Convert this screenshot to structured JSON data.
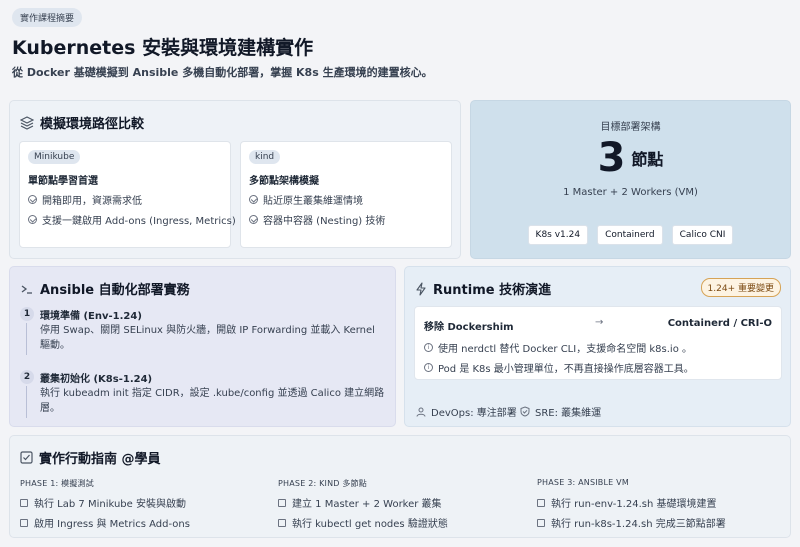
{
  "header": {
    "badge": "實作課程摘要",
    "title": "Kubernetes 安裝與環境建構實作",
    "subtitle": "從 Docker 基礎模擬到 Ansible 多機自動化部署，掌握 K8s 生產環境的建置核心。"
  },
  "env": {
    "title": "模擬環境路徑比較",
    "cards": [
      {
        "tag": "Minikube",
        "title": "單節點學習首選",
        "items": [
          "開箱即用，資源需求低",
          "支援一鍵啟用 Add-ons (Ingress, Metrics)"
        ]
      },
      {
        "tag": "kind",
        "title": "多節點架構模擬",
        "items": [
          "貼近原生叢集維運情境",
          "容器中容器 (Nesting) 技術"
        ]
      }
    ]
  },
  "target": {
    "label": "目標部署架構",
    "number": "3",
    "unit": "節點",
    "desc": "1 Master + 2 Workers (VM)",
    "badges": [
      "K8s v1.24",
      "Containerd",
      "Calico CNI"
    ]
  },
  "ansible": {
    "title": "Ansible 自動化部署實務",
    "steps": [
      {
        "num": "1",
        "title": "環境準備 (Env-1.24)",
        "desc": "停用 Swap、關閉 SELinux 與防火牆，開啟 IP Forwarding 並載入 Kernel 驅動。"
      },
      {
        "num": "2",
        "title": "叢集初始化 (K8s-1.24)",
        "desc": "執行 kubeadm init 指定 CIDR，設定 .kube/config 並透過 Calico 建立網路層。"
      }
    ]
  },
  "runtime": {
    "title": "Runtime 技術演進",
    "badge": "1.24+ 重要變更",
    "from": "移除 Dockershim",
    "arrow": "→",
    "to": "Containerd / CRI-O",
    "notes": [
      "使用 nerdctl 替代 Docker CLI，支援命名空間 k8s.io 。",
      "Pod 是 K8s 最小管理單位，不再直接操作底層容器工具。"
    ],
    "roles": [
      "DevOps: 專注部署",
      "SRE: 叢集維運"
    ]
  },
  "guide": {
    "title": "實作行動指南 @學員",
    "phases": [
      {
        "label": "PHASE 1: 模擬測試",
        "items": [
          "執行 Lab 7 Minikube 安裝與啟動",
          "啟用 Ingress 與 Metrics Add-ons"
        ]
      },
      {
        "label": "PHASE 2: KIND 多節點",
        "items": [
          "建立 1 Master + 2 Worker 叢集",
          "執行 kubectl get nodes 驗證狀態"
        ]
      },
      {
        "label": "PHASE 3: ANSIBLE VM",
        "items": [
          "執行 run-env-1.24.sh 基礎環境建置",
          "執行 run-k8s-1.24.sh 完成三節點部署"
        ]
      }
    ]
  }
}
